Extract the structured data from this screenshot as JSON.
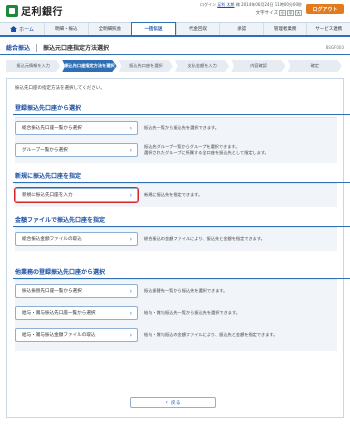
{
  "header": {
    "bank_name": "足利銀行",
    "user_prefix": "ログイン",
    "user_name": "足利 太郎",
    "user_suffix": "様",
    "last_login": "2014年06月24日 11時00分00秒",
    "font_size_label": "文字サイズ",
    "font_sizes": [
      "小",
      "中",
      "大"
    ],
    "logout_label": "ログアウト"
  },
  "nav": {
    "home_label": "ホーム",
    "items": [
      "明細・振込",
      "全明細照会",
      "一括伝送",
      "代金回収",
      "承認",
      "管理者業務",
      "サービス連携"
    ],
    "active_index": 2
  },
  "title": {
    "section": "総合振込",
    "page": "振込元口座指定方法選択",
    "code": "BSGF003"
  },
  "steps": [
    "振込元情報を入力",
    "振込先口座指定方法を選択",
    "振込先口座を選択",
    "支払金額を入力",
    "内容確認",
    "確定"
  ],
  "active_step": 1,
  "intro_text": "振込先口座の指定方法を選択してください。",
  "sections": {
    "registered": {
      "title": "登録振込先口座から選択",
      "buttons": [
        {
          "label": "総合振込先口座一覧から選択",
          "desc": "振込先一覧から振込先を選択できます。"
        },
        {
          "label": "グループ一覧から選択",
          "desc": "振込先グループ一覧からグループを選択できます。",
          "desc2": "選択されたグループに所属する全口座を振込先として指定します。"
        }
      ]
    },
    "new": {
      "title": "新規に振込先口座を指定",
      "buttons": [
        {
          "label": "新規に振込先口座を入力",
          "desc": "新規に振込先を指定できます。"
        }
      ]
    },
    "file": {
      "title": "金額ファイルで振込先口座を指定",
      "buttons": [
        {
          "label": "総合振込金額ファイルの取込",
          "desc": "総合振込の金額ファイルにより、振込先と金額を指定できます。"
        }
      ]
    },
    "other": {
      "title": "他業務の登録振込先口座から選択",
      "buttons": [
        {
          "label": "振込振替先口座一覧から選択",
          "desc": "振込振替先一覧から振込先を選択できます。"
        },
        {
          "label": "給与・賞与振込先口座一覧から選択",
          "desc": "給与・賞与振込先一覧から振込先を選択できます。"
        },
        {
          "label": "給与・賞与振込金額ファイルの取込",
          "desc": "給与・賞与振込の金額ファイルにより、振込先と金額を指定できます。"
        }
      ]
    }
  },
  "back_label": "戻る",
  "colors": {
    "brand_green": "#1c8a3b",
    "accent_blue": "#2e6fb5",
    "logout_orange": "#e27b1d",
    "highlight_red": "#d8262a"
  }
}
